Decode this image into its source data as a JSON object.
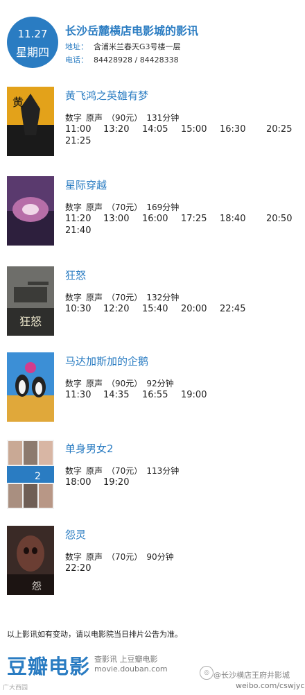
{
  "header": {
    "date": "11.27",
    "weekday": "星期四",
    "cinema": "长沙岳麓横店电影城的影讯",
    "address_label": "地址：",
    "address": "含浦米兰春天G3号楼一层",
    "phone_label": "电话：",
    "phone": "84428928 / 84428338"
  },
  "movies": [
    {
      "title": "黄飞鸿之英雄有梦",
      "format": "数字",
      "lang": "原声",
      "price": "（90元）",
      "duration": "131分钟",
      "times": [
        "11:00",
        "13:20",
        "14:05",
        "15:00",
        "16:30",
        "20:25",
        "21:25"
      ]
    },
    {
      "title": "星际穿越",
      "format": "数字",
      "lang": "原声",
      "price": "（70元）",
      "duration": "169分钟",
      "times": [
        "11:20",
        "13:00",
        "16:00",
        "17:25",
        "18:40",
        "20:50",
        "21:40"
      ]
    },
    {
      "title": "狂怒",
      "format": "数字",
      "lang": "原声",
      "price": "（70元）",
      "duration": "132分钟",
      "times": [
        "10:30",
        "12:20",
        "15:40",
        "20:00",
        "22:45"
      ]
    },
    {
      "title": "马达加斯加的企鹅",
      "format": "数字",
      "lang": "原声",
      "price": "（90元）",
      "duration": "92分钟",
      "times": [
        "11:30",
        "14:35",
        "16:55",
        "19:00"
      ]
    },
    {
      "title": "单身男女2",
      "format": "数字",
      "lang": "原声",
      "price": "（70元）",
      "duration": "113分钟",
      "times": [
        "18:00",
        "19:20"
      ]
    },
    {
      "title": "怨灵",
      "format": "数字",
      "lang": "原声",
      "price": "（70元）",
      "duration": "90分钟",
      "times": [
        "22:20"
      ]
    }
  ],
  "notice": "以上影讯如有变动，请以电影院当日排片公告为准。",
  "footer": {
    "logo": "豆瓣电影",
    "tagline": "查影讯  上豆瓣电影",
    "url": "movie.douban.com",
    "watermark1": "@长沙横店王府井影城",
    "watermark2": "weibo.com/cswjyc",
    "small_watermark": "广大西园"
  },
  "colors": {
    "accent": "#2a7cc2"
  }
}
